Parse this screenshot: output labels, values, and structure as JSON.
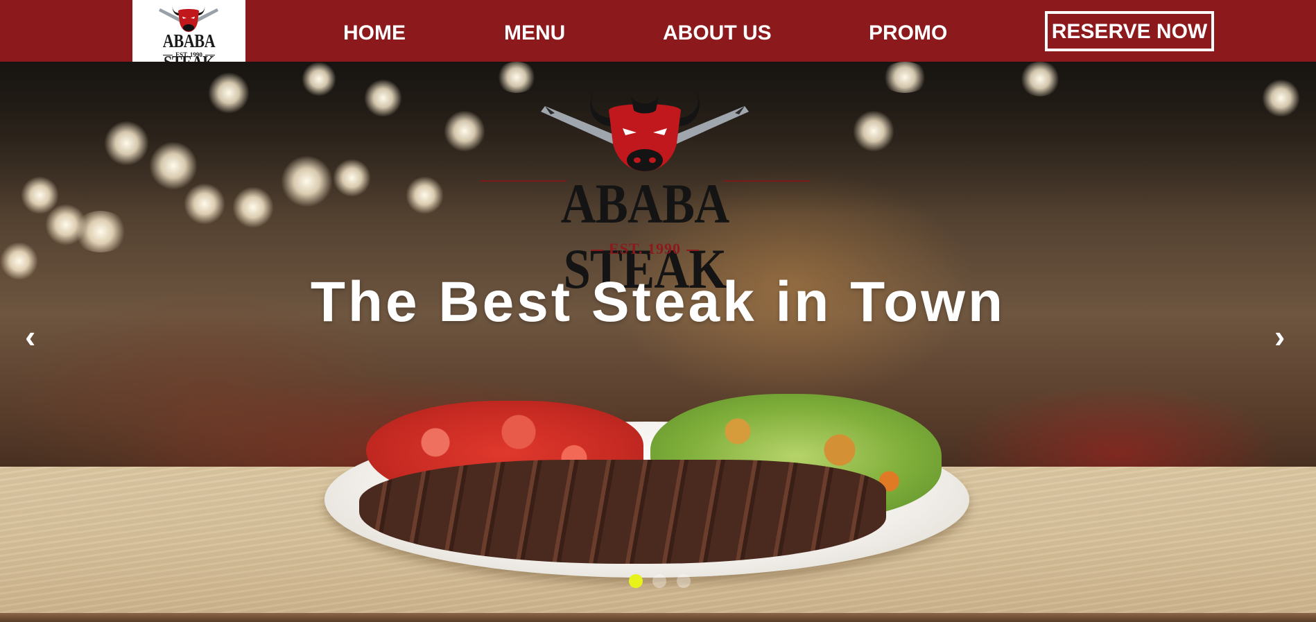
{
  "brand": {
    "name": "ABABA STEAK",
    "established": "EST. 1990"
  },
  "nav": {
    "links": [
      "HOME",
      "MENU",
      "ABOUT US",
      "PROMO"
    ],
    "reserve_label": "RESERVE NOW"
  },
  "hero": {
    "headline": "The Best Steak in Town",
    "prev_arrow": "‹",
    "next_arrow": "›",
    "slide_count": 3,
    "active_slide": 1
  },
  "colors": {
    "nav_bg": "#8c191c",
    "dot_active": "#e8f21b",
    "text": "#ffffff"
  },
  "icons": [
    "bull-logo-icon",
    "chevron-left-icon",
    "chevron-right-icon"
  ]
}
